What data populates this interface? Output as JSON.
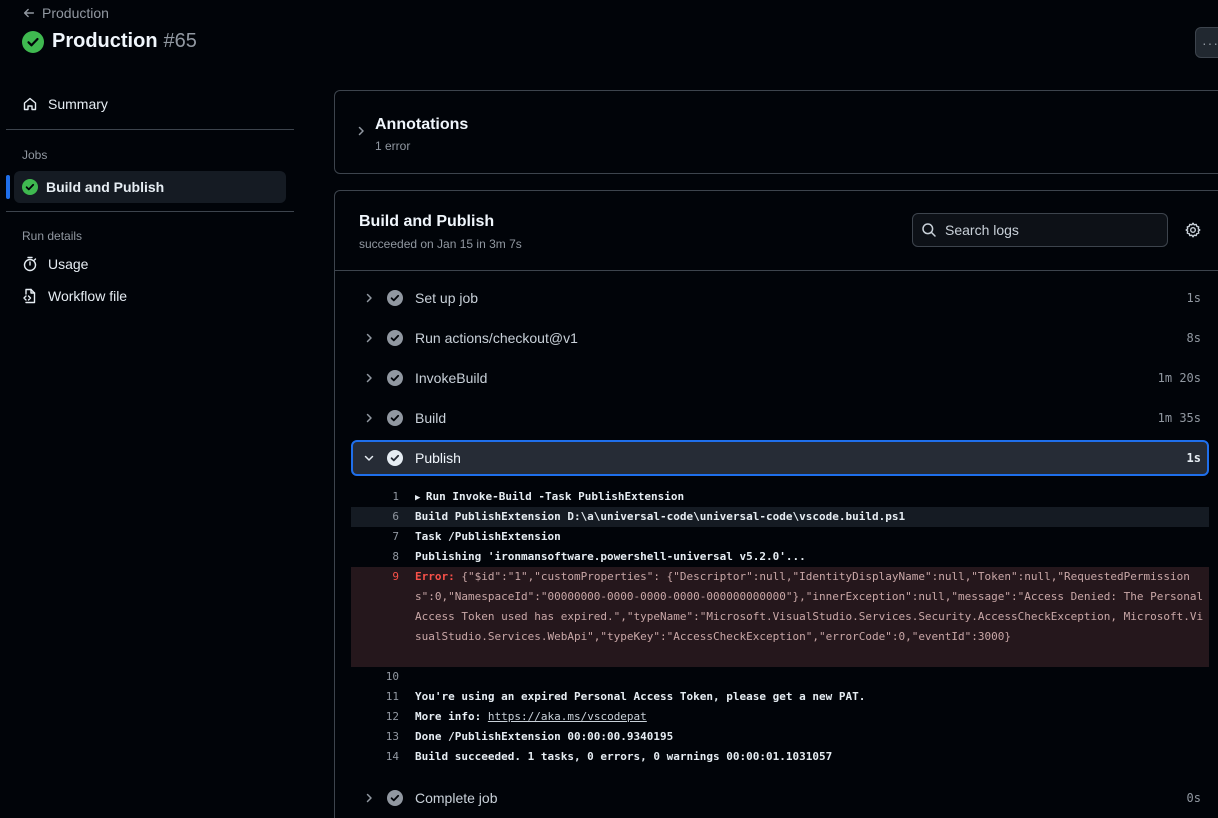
{
  "header": {
    "breadcrumb": "Production",
    "title": "Production",
    "run_number": "#65",
    "more_label": "···"
  },
  "sidebar": {
    "summary": "Summary",
    "jobs_label": "Jobs",
    "active_job": "Build and Publish",
    "run_details_label": "Run details",
    "usage": "Usage",
    "workflow_file": "Workflow file"
  },
  "annotations": {
    "title": "Annotations",
    "subtitle": "1 error"
  },
  "job": {
    "title": "Build and Publish",
    "subtitle": "succeeded on Jan 15 in 3m 7s",
    "search_placeholder": "Search logs"
  },
  "steps": [
    {
      "name": "Set up job",
      "duration": "1s"
    },
    {
      "name": "Run actions/checkout@v1",
      "duration": "8s"
    },
    {
      "name": "InvokeBuild",
      "duration": "1m 20s"
    },
    {
      "name": "Build",
      "duration": "1m 35s"
    },
    {
      "name": "Publish",
      "duration": "1s"
    },
    {
      "name": "Complete job",
      "duration": "0s"
    }
  ],
  "log": {
    "l1_num": "1",
    "l1_text": "Run Invoke-Build -Task PublishExtension",
    "l6_num": "6",
    "l6_text": "Build PublishExtension D:\\a\\universal-code\\universal-code\\vscode.build.ps1",
    "l7_num": "7",
    "l7_text": "Task /PublishExtension",
    "l8_num": "8",
    "l8_text": "Publishing 'ironmansoftware.powershell-universal v5.2.0'...",
    "l9_num": "9",
    "l9_label": "Error:",
    "l9_text": "{\"$id\":\"1\",\"customProperties\": {\"Descriptor\":null,\"IdentityDisplayName\":null,\"Token\":null,\"RequestedPermissions\":0,\"NamespaceId\":\"00000000-0000-0000-0000-000000000000\"},\"innerException\":null,\"message\":\"Access Denied: The Personal Access Token used has expired.\",\"typeName\":\"Microsoft.VisualStudio.Services.Security.AccessCheckException, Microsoft.VisualStudio.Services.WebApi\",\"typeKey\":\"AccessCheckException\",\"errorCode\":0,\"eventId\":3000}",
    "l10_num": "10",
    "l11_num": "11",
    "l11_text": "You're using an expired Personal Access Token, please get a new PAT.",
    "l12_num": "12",
    "l12_text": "More info: ",
    "l12_link": "https://aka.ms/vscodepat",
    "l13_num": "13",
    "l13_text": "Done /PublishExtension 00:00:00.9340195",
    "l14_num": "14",
    "l14_text": "Build succeeded. 1 tasks, 0 errors, 0 warnings 00:00:01.1031057"
  },
  "colors": {
    "background": "#010409",
    "success": "#3fb950",
    "accent": "#1f6feb",
    "error": "#f85149",
    "border": "#3d444d"
  }
}
